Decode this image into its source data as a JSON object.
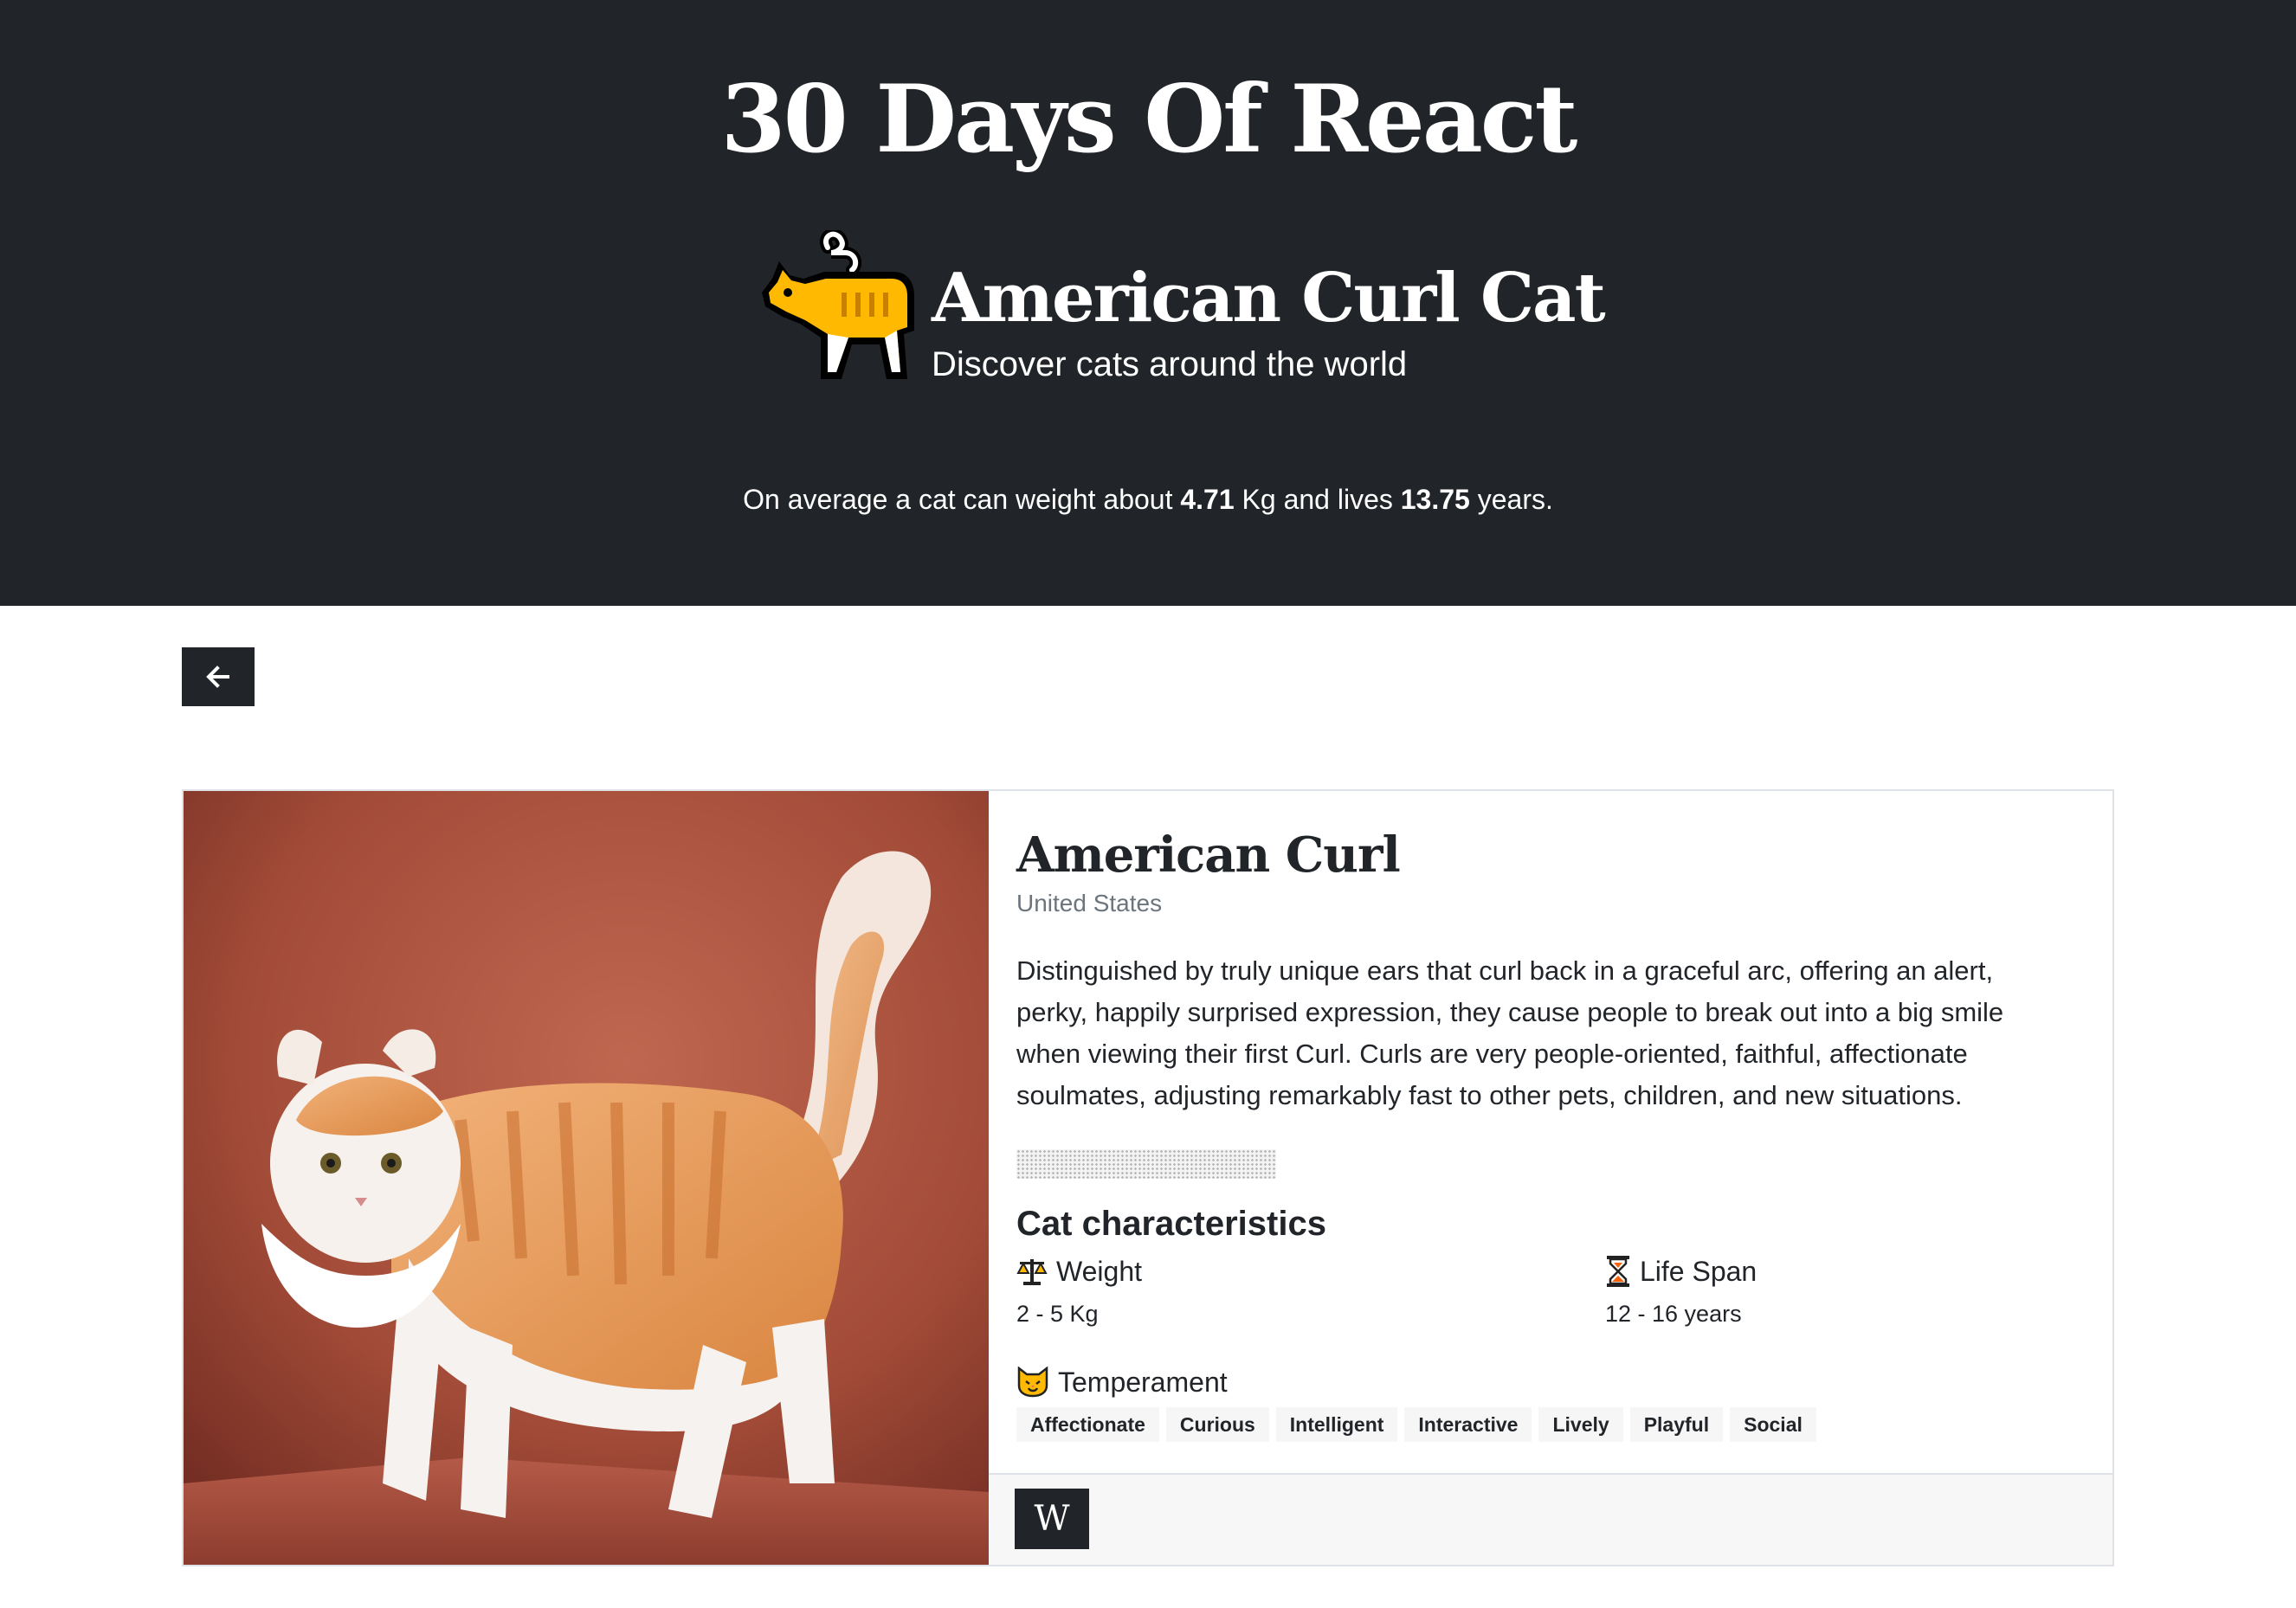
{
  "header": {
    "site_title": "30 Days Of React",
    "brand_title": "American Curl Cat",
    "brand_subtitle": "Discover cats around the world",
    "stats": {
      "prefix": "On average a cat can weight about ",
      "weight": "4.71",
      "middle": " Kg and lives ",
      "lifespan": "13.75",
      "suffix": " years."
    },
    "logo_icon": "cat-icon",
    "accent_color": "#ffb900"
  },
  "nav": {
    "back_icon": "arrow-left-icon"
  },
  "breed": {
    "name": "American Curl",
    "origin": "United States",
    "description": "Distinguished by truly unique ears that curl back in a graceful arc, offering an alert, perky, happily surprised expression, they cause people to break out into a big smile when viewing their first Curl. Curls are very people-oriented, faithful, affectionate soulmates, adjusting remarkably fast to other pets, children, and new situations.",
    "characteristics_heading": "Cat characteristics",
    "weight": {
      "label": "Weight",
      "value": "2 - 5 Kg",
      "icon": "balance-scale-icon"
    },
    "lifespan": {
      "label": "Life Span",
      "value": "12 - 16 years",
      "icon": "hourglass-icon"
    },
    "temperament": {
      "label": "Temperament",
      "icon": "cat-face-icon",
      "tags": [
        "Affectionate",
        "Curious",
        "Intelligent",
        "Interactive",
        "Lively",
        "Playful",
        "Social"
      ]
    },
    "wiki_label": "W"
  },
  "colors": {
    "header_bg": "#212529",
    "photo_bg": "#a84e3c",
    "cat_orange": "#e89a52"
  }
}
